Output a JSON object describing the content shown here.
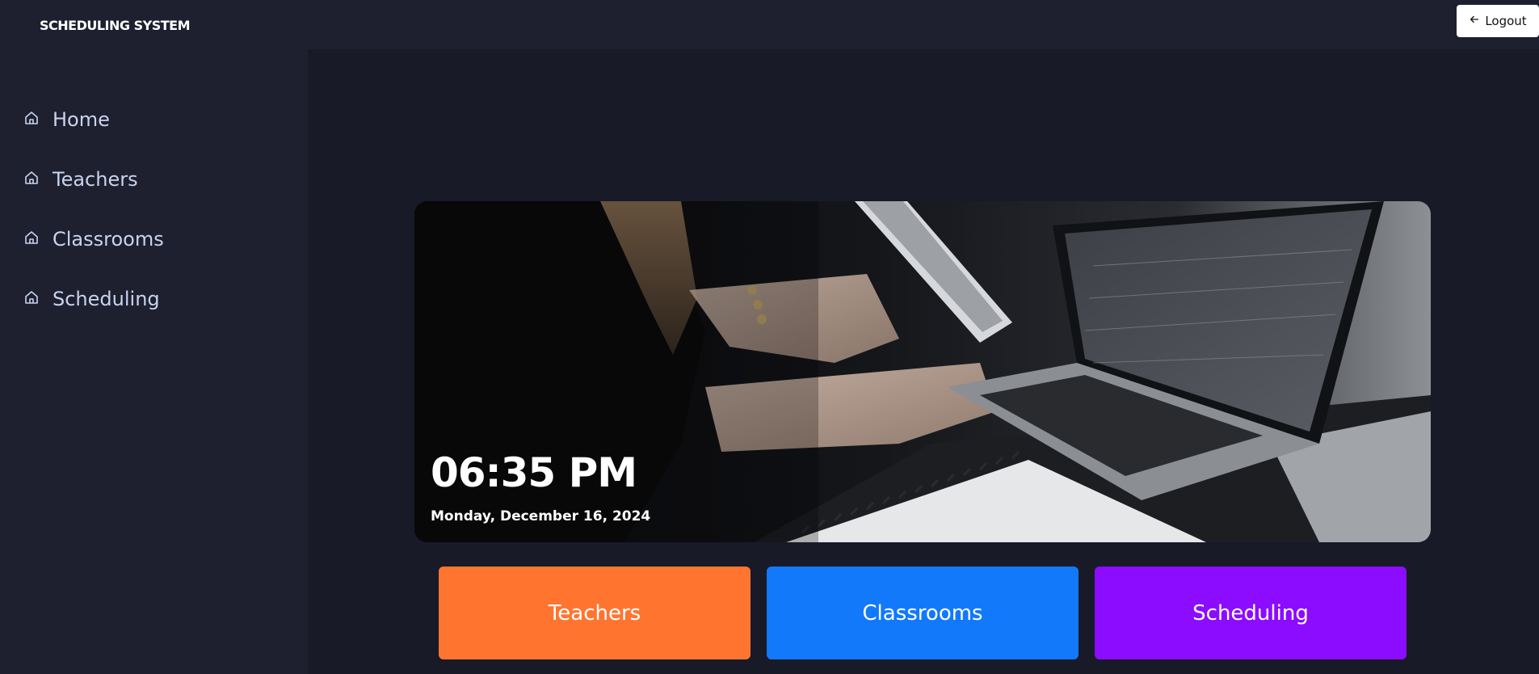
{
  "app": {
    "title": "SCHEDULING SYSTEM"
  },
  "header": {
    "logout_label": "Logout",
    "logout_icon": "arrow-left-icon"
  },
  "sidebar": {
    "items": [
      {
        "label": "Home",
        "icon": "home-icon"
      },
      {
        "label": "Teachers",
        "icon": "home-icon"
      },
      {
        "label": "Classrooms",
        "icon": "home-icon"
      },
      {
        "label": "Scheduling",
        "icon": "home-icon"
      }
    ]
  },
  "hero": {
    "time": "06:35 PM",
    "date": "Monday, December 16, 2024"
  },
  "tiles": [
    {
      "label": "Teachers",
      "color": "#ff7530"
    },
    {
      "label": "Classrooms",
      "color": "#1279fb"
    },
    {
      "label": "Scheduling",
      "color": "#8b0cff"
    }
  ],
  "colors": {
    "sidebar_bg": "#1e2030",
    "main_bg": "#181a27",
    "nav_text": "#c9d3ee"
  }
}
